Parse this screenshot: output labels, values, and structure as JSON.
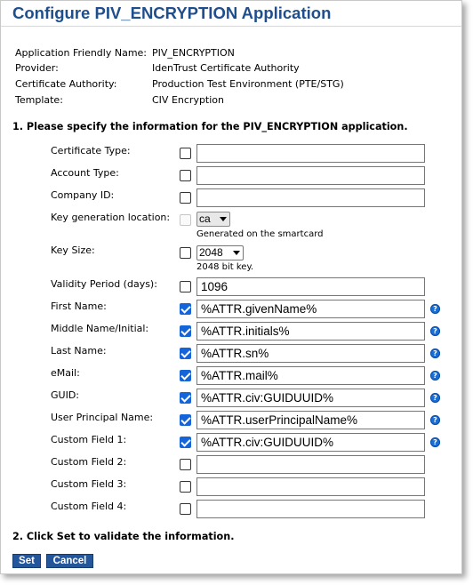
{
  "title": "Configure PIV_ENCRYPTION Application",
  "info": [
    {
      "label": "Application Friendly Name:",
      "value": "PIV_ENCRYPTION"
    },
    {
      "label": "Provider:",
      "value": "IdenTrust Certificate Authority"
    },
    {
      "label": "Certificate Authority:",
      "value": "Production Test Environment (PTE/STG)"
    },
    {
      "label": "Template:",
      "value": "CIV Encryption"
    }
  ],
  "section1": "1. Please specify the information for the PIV_ENCRYPTION application.",
  "fields": {
    "certificate_type": {
      "label": "Certificate Type:",
      "checked": false,
      "value": ""
    },
    "account_type": {
      "label": "Account Type:",
      "checked": false,
      "value": ""
    },
    "company_id": {
      "label": "Company ID:",
      "checked": false,
      "value": ""
    },
    "key_location": {
      "label": "Key generation location:",
      "checked": false,
      "disabled": true,
      "selected": "ca",
      "note": "Generated on the smartcard"
    },
    "key_size": {
      "label": "Key Size:",
      "checked": false,
      "selected": "2048",
      "note": "2048 bit key."
    },
    "validity_period": {
      "label": "Validity Period (days):",
      "checked": false,
      "value": "1096"
    },
    "first_name": {
      "label": "First Name:",
      "checked": true,
      "value": "%ATTR.givenName%"
    },
    "middle_name": {
      "label": "Middle Name/Initial:",
      "checked": true,
      "value": "%ATTR.initials%"
    },
    "last_name": {
      "label": "Last Name:",
      "checked": true,
      "value": "%ATTR.sn%"
    },
    "email": {
      "label": "eMail:",
      "checked": true,
      "value": "%ATTR.mail%"
    },
    "guid": {
      "label": "GUID:",
      "checked": true,
      "value": "%ATTR.civ:GUIDUUID%"
    },
    "upn": {
      "label": "User Principal Name:",
      "checked": true,
      "value": "%ATTR.userPrincipalName%"
    },
    "custom1": {
      "label": "Custom Field 1:",
      "checked": true,
      "value": "%ATTR.civ:GUIDUUID%"
    },
    "custom2": {
      "label": "Custom Field 2:",
      "checked": false,
      "value": ""
    },
    "custom3": {
      "label": "Custom Field 3:",
      "checked": false,
      "value": ""
    },
    "custom4": {
      "label": "Custom Field 4:",
      "checked": false,
      "value": ""
    }
  },
  "help_icon": "?",
  "section2": "2. Click Set to validate the information.",
  "buttons": {
    "set": "Set",
    "cancel": "Cancel"
  },
  "colors": {
    "title": "#1f4e8c",
    "button": "#23569a",
    "checkbox": "#1565d8",
    "help_icon": "#1a6fd6"
  }
}
